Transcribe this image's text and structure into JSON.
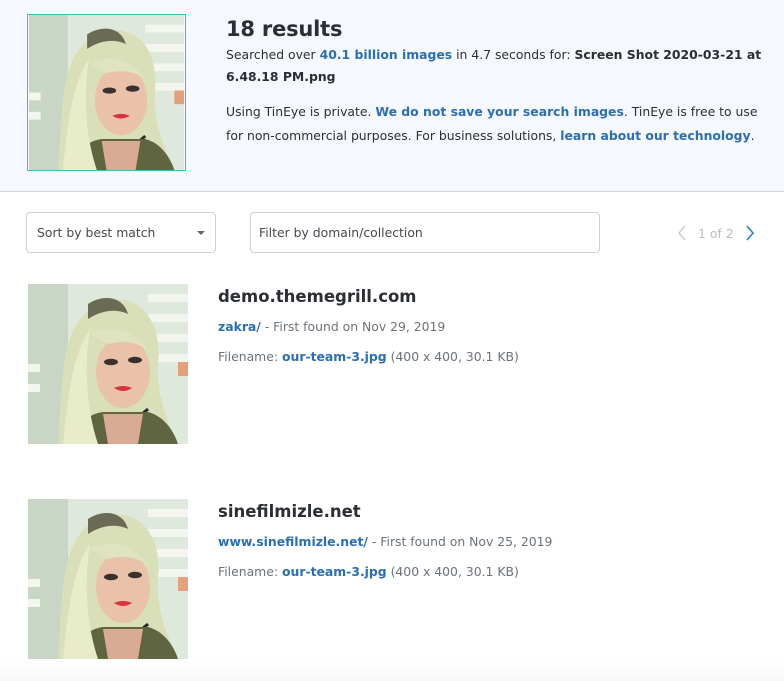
{
  "header": {
    "results_count": "18 results",
    "search_prefix": "Searched over ",
    "index_size_link": "40.1 billion images",
    "search_mid": " in 4.7 seconds for: ",
    "query_filename": "Screen Shot 2020-03-21 at 6.48.18 PM.png",
    "privacy_prefix": "Using TinEye is private. ",
    "privacy_link": "We do not save your search images",
    "privacy_mid": ". TinEye is free to use for non-commercial purposes. For business solutions, ",
    "technology_link": "learn about our technology",
    "privacy_suffix": ".",
    "query_image_alt": "Uploaded search image"
  },
  "toolbar": {
    "sort_label": "Sort by best match",
    "filter_placeholder": "Filter by domain/collection",
    "current_page": "1",
    "page_separator": "of",
    "total_pages": "2",
    "page_text": "1 of 2"
  },
  "results": [
    {
      "domain": "demo.themegrill.com",
      "path_link": "zakra/",
      "first_found": " - First found on Nov 29, 2019",
      "filename_label": "Filename: ",
      "filename_link": "our-team-3.jpg",
      "file_details": " (400 x 400, 30.1 KB)"
    },
    {
      "domain": "sinefilmizle.net",
      "path_link": "www.sinefilmizle.net/",
      "first_found": " - First found on Nov 25, 2019",
      "filename_label": "Filename: ",
      "filename_link": "our-team-3.jpg",
      "file_details": " (400 x 400, 30.1 KB)"
    }
  ],
  "colors": {
    "link": "#2a6fb3",
    "header_bg": "#f5f8fc",
    "thumb_border": "#2ec6bf",
    "pager_inactive": "#b4bcc4"
  }
}
